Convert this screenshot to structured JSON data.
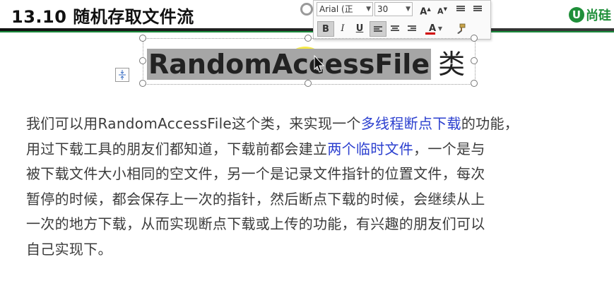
{
  "header": {
    "title": "13.10 随机存取文件流",
    "logo_mark": "U",
    "logo_text": "尚硅"
  },
  "toolbar": {
    "font_name": "Arial (正",
    "font_size": "30",
    "grow_font": "A",
    "shrink_font": "A",
    "bold": "B",
    "italic": "I",
    "underline": "U",
    "font_color": "A",
    "font_color_hex": "#d00000"
  },
  "title_box": {
    "selected_text": "RandomAccessFile",
    "suffix": "类"
  },
  "paragraph": {
    "segments": [
      {
        "text": "我们可以用RandomAccessFile这个类，来实现一个",
        "link": false
      },
      {
        "text": "多线程断点下载",
        "link": true
      },
      {
        "text": "的功能，用过下载工具的朋友们都知道，下载前都会建立",
        "link": false
      },
      {
        "text": "两个临时文件",
        "link": true
      },
      {
        "text": "，一个是与被下载文件大小相同的空文件，另一个是记录文件指针的位置文件，每次暂停的时候，都会保存上一次的指针，然后断点下载的时候，会继续从上一次的地方下载，从而实现断点下载或上传的功能，有兴趣的朋友们可以自己实现下。",
        "link": false
      }
    ],
    "lines": [
      [
        {
          "text": "我们可以用RandomAccessFile这个类，来实现一个",
          "link": false
        },
        {
          "text": "多线程断点下载",
          "link": true
        },
        {
          "text": "的功能，",
          "link": false
        }
      ],
      [
        {
          "text": "用过下载工具的朋友们都知道，下载前都会建立",
          "link": false
        },
        {
          "text": "两个临时文件",
          "link": true
        },
        {
          "text": "，一个是与",
          "link": false
        }
      ],
      [
        {
          "text": "被下载文件大小相同的空文件，另一个是记录文件指针的位置文件，每次",
          "link": false
        }
      ],
      [
        {
          "text": "暂停的时候，都会保存上一次的指针，然后断点下载的时候，会继续从上",
          "link": false
        }
      ],
      [
        {
          "text": "一次的地方下载，从而实现断点下载或上传的功能，有兴趣的朋友们可以",
          "link": false
        }
      ],
      [
        {
          "text": "自己实现下。",
          "link": false
        }
      ]
    ]
  },
  "colors": {
    "header_green": "#1a8a3c",
    "link_blue": "#2b3fcf",
    "selection_gray": "#a6a6a6",
    "cursor_yellow": "#f5e628"
  }
}
